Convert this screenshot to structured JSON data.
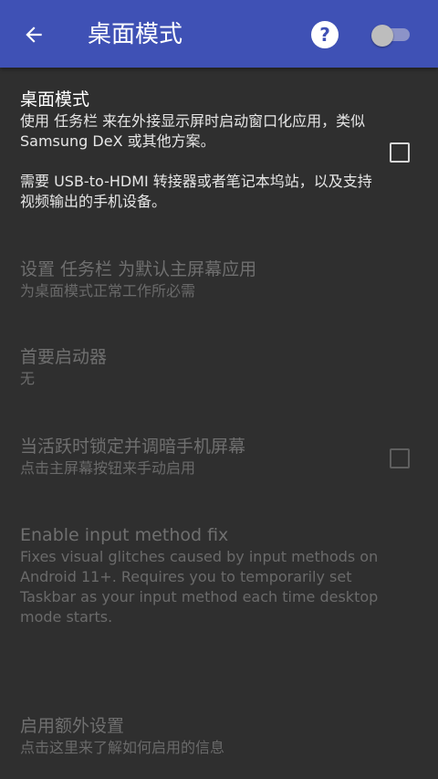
{
  "appbar": {
    "title": "桌面模式",
    "back_icon": "arrow-back-icon",
    "help_icon": "help-circle-icon",
    "help_glyph": "?",
    "switch_on": false,
    "color": "#3f51b5"
  },
  "prefs": {
    "desktop_mode": {
      "title": "桌面模式",
      "summary_1": "使用 任务栏 来在外接显示屏时启动窗口化应用，类似 Samsung DeX 或其他方案。",
      "summary_2": "需要 USB-to-HDMI 转接器或者笔记本坞站，以及支持视频输出的手机设备。",
      "checked": false
    },
    "set_default_home": {
      "title": "设置 任务栏 为默认主屏幕应用",
      "summary": "为桌面模式正常工作所必需"
    },
    "primary_launcher": {
      "title": "首要启动器",
      "summary": "无"
    },
    "lock_dim": {
      "title": "当活跃时锁定并调暗手机屏幕",
      "summary": "点击主屏幕按钮来手动启用",
      "checked": false
    },
    "ime_fix": {
      "title": "Enable input method fix",
      "summary": "Fixes visual glitches caused by input methods on Android 11+. Requires you to temporarily set Taskbar as your input method each time desktop mode starts."
    },
    "extra_settings": {
      "title": "启用额外设置",
      "summary": "点击这里来了解如何启用的信息"
    }
  }
}
